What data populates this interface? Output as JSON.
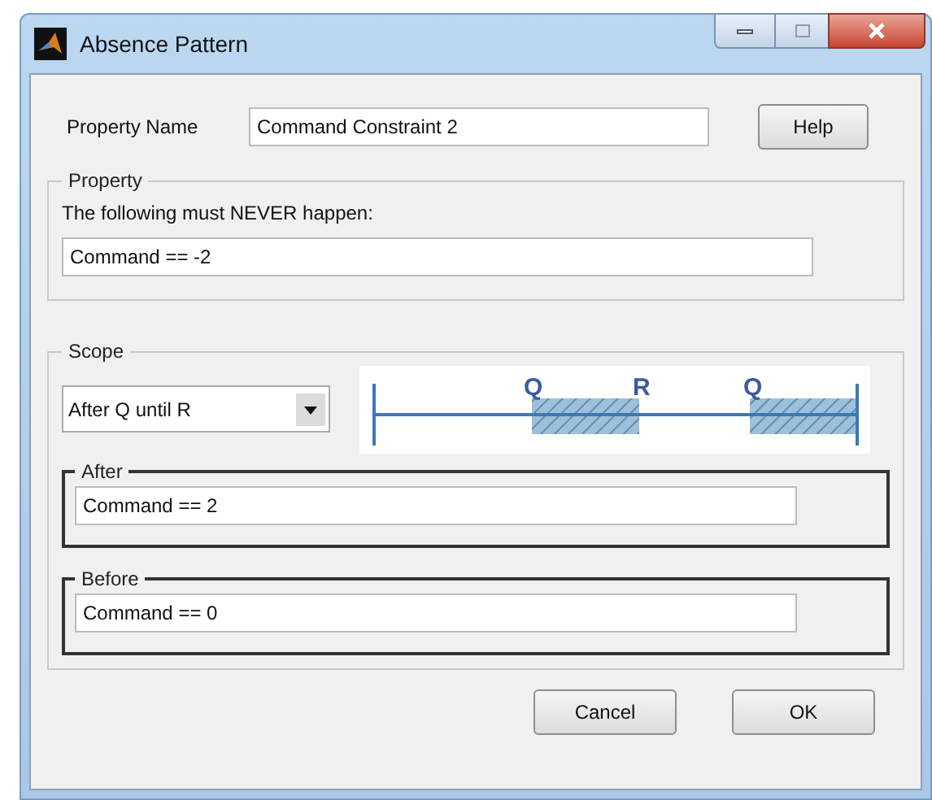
{
  "window": {
    "title": "Absence Pattern"
  },
  "property_name": {
    "label": "Property Name",
    "value": "Command Constraint 2"
  },
  "help_button": "Help",
  "property": {
    "legend": "Property",
    "prompt": "The following must NEVER happen:",
    "value": "Command == -2"
  },
  "scope": {
    "legend": "Scope",
    "dropdown": {
      "value": "After Q until R"
    },
    "diagram_labels": [
      "Q",
      "R",
      "Q"
    ],
    "after": {
      "legend": "After",
      "value": "Command == 2"
    },
    "before": {
      "legend": "Before",
      "value": "Command == 0"
    }
  },
  "buttons": [
    "Cancel",
    "OK"
  ]
}
